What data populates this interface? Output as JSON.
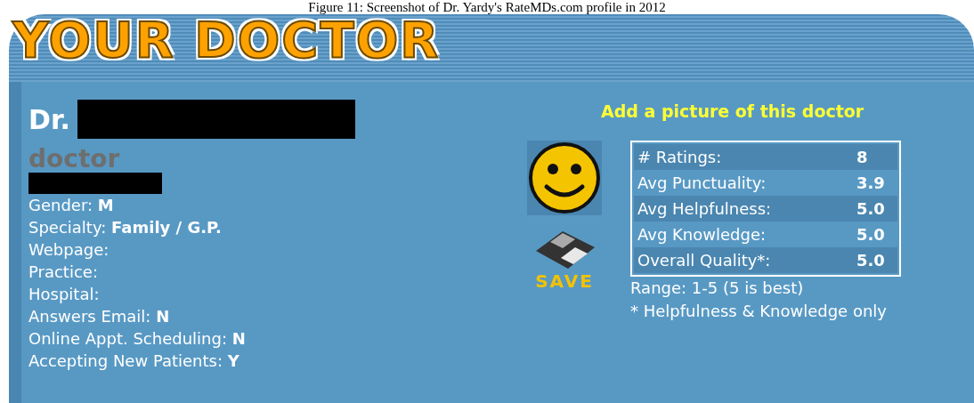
{
  "caption": "Figure 11: Screenshot of Dr. Yardy's RateMDs.com profile in 2012",
  "header": {
    "logo": "YOUR DOCTOR"
  },
  "profile": {
    "title_prefix": "Dr.",
    "subtitle": "doctor",
    "fields": [
      {
        "label": "Gender:",
        "value": "M"
      },
      {
        "label": "Specialty:",
        "value": "Family / G.P."
      },
      {
        "label": "Webpage:"
      },
      {
        "label": "Practice:"
      },
      {
        "label": "Hospital:"
      },
      {
        "label": "Answers Email:",
        "value": "N"
      },
      {
        "label": "Online Appt. Scheduling:",
        "value": "N"
      },
      {
        "label": "Accepting New Patients:",
        "value": "Y"
      }
    ]
  },
  "picture_link": "Add a picture of this doctor",
  "save_label": "SAVE",
  "ratings": [
    {
      "label": "# Ratings:",
      "value": "8"
    },
    {
      "label": "Avg Punctuality:",
      "value": "3.9"
    },
    {
      "label": "Avg Helpfulness:",
      "value": "5.0"
    },
    {
      "label": "Avg Knowledge:",
      "value": "5.0"
    },
    {
      "label": "Overall Quality*:",
      "value": "5.0"
    }
  ],
  "notes": [
    "Range: 1-5 (5 is best)",
    "* Helpfulness & Knowledge only"
  ]
}
